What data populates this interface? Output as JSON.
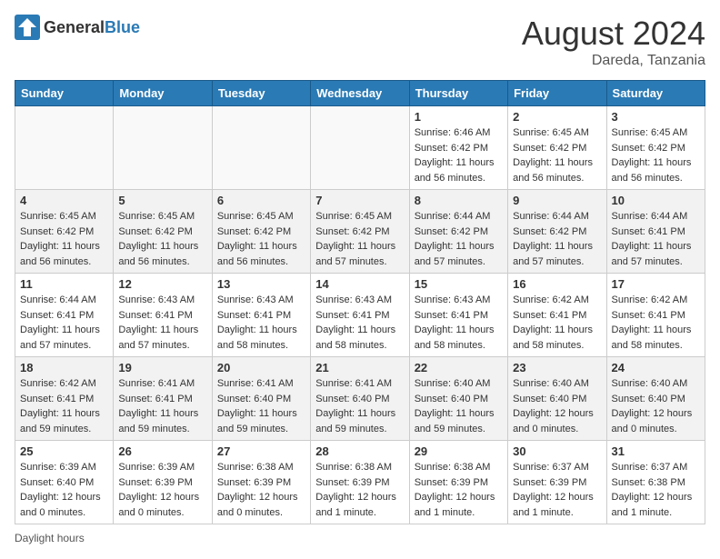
{
  "header": {
    "logo_general": "General",
    "logo_blue": "Blue",
    "month_year": "August 2024",
    "location": "Dareda, Tanzania"
  },
  "days_of_week": [
    "Sunday",
    "Monday",
    "Tuesday",
    "Wednesday",
    "Thursday",
    "Friday",
    "Saturday"
  ],
  "weeks": [
    [
      {
        "day": "",
        "sunrise": "",
        "sunset": "",
        "daylight": "",
        "empty": true
      },
      {
        "day": "",
        "sunrise": "",
        "sunset": "",
        "daylight": "",
        "empty": true
      },
      {
        "day": "",
        "sunrise": "",
        "sunset": "",
        "daylight": "",
        "empty": true
      },
      {
        "day": "",
        "sunrise": "",
        "sunset": "",
        "daylight": "",
        "empty": true
      },
      {
        "day": "1",
        "sunrise": "Sunrise: 6:46 AM",
        "sunset": "Sunset: 6:42 PM",
        "daylight": "Daylight: 11 hours and 56 minutes."
      },
      {
        "day": "2",
        "sunrise": "Sunrise: 6:45 AM",
        "sunset": "Sunset: 6:42 PM",
        "daylight": "Daylight: 11 hours and 56 minutes."
      },
      {
        "day": "3",
        "sunrise": "Sunrise: 6:45 AM",
        "sunset": "Sunset: 6:42 PM",
        "daylight": "Daylight: 11 hours and 56 minutes."
      }
    ],
    [
      {
        "day": "4",
        "sunrise": "Sunrise: 6:45 AM",
        "sunset": "Sunset: 6:42 PM",
        "daylight": "Daylight: 11 hours and 56 minutes."
      },
      {
        "day": "5",
        "sunrise": "Sunrise: 6:45 AM",
        "sunset": "Sunset: 6:42 PM",
        "daylight": "Daylight: 11 hours and 56 minutes."
      },
      {
        "day": "6",
        "sunrise": "Sunrise: 6:45 AM",
        "sunset": "Sunset: 6:42 PM",
        "daylight": "Daylight: 11 hours and 56 minutes."
      },
      {
        "day": "7",
        "sunrise": "Sunrise: 6:45 AM",
        "sunset": "Sunset: 6:42 PM",
        "daylight": "Daylight: 11 hours and 57 minutes."
      },
      {
        "day": "8",
        "sunrise": "Sunrise: 6:44 AM",
        "sunset": "Sunset: 6:42 PM",
        "daylight": "Daylight: 11 hours and 57 minutes."
      },
      {
        "day": "9",
        "sunrise": "Sunrise: 6:44 AM",
        "sunset": "Sunset: 6:42 PM",
        "daylight": "Daylight: 11 hours and 57 minutes."
      },
      {
        "day": "10",
        "sunrise": "Sunrise: 6:44 AM",
        "sunset": "Sunset: 6:41 PM",
        "daylight": "Daylight: 11 hours and 57 minutes."
      }
    ],
    [
      {
        "day": "11",
        "sunrise": "Sunrise: 6:44 AM",
        "sunset": "Sunset: 6:41 PM",
        "daylight": "Daylight: 11 hours and 57 minutes."
      },
      {
        "day": "12",
        "sunrise": "Sunrise: 6:43 AM",
        "sunset": "Sunset: 6:41 PM",
        "daylight": "Daylight: 11 hours and 57 minutes."
      },
      {
        "day": "13",
        "sunrise": "Sunrise: 6:43 AM",
        "sunset": "Sunset: 6:41 PM",
        "daylight": "Daylight: 11 hours and 58 minutes."
      },
      {
        "day": "14",
        "sunrise": "Sunrise: 6:43 AM",
        "sunset": "Sunset: 6:41 PM",
        "daylight": "Daylight: 11 hours and 58 minutes."
      },
      {
        "day": "15",
        "sunrise": "Sunrise: 6:43 AM",
        "sunset": "Sunset: 6:41 PM",
        "daylight": "Daylight: 11 hours and 58 minutes."
      },
      {
        "day": "16",
        "sunrise": "Sunrise: 6:42 AM",
        "sunset": "Sunset: 6:41 PM",
        "daylight": "Daylight: 11 hours and 58 minutes."
      },
      {
        "day": "17",
        "sunrise": "Sunrise: 6:42 AM",
        "sunset": "Sunset: 6:41 PM",
        "daylight": "Daylight: 11 hours and 58 minutes."
      }
    ],
    [
      {
        "day": "18",
        "sunrise": "Sunrise: 6:42 AM",
        "sunset": "Sunset: 6:41 PM",
        "daylight": "Daylight: 11 hours and 59 minutes."
      },
      {
        "day": "19",
        "sunrise": "Sunrise: 6:41 AM",
        "sunset": "Sunset: 6:41 PM",
        "daylight": "Daylight: 11 hours and 59 minutes."
      },
      {
        "day": "20",
        "sunrise": "Sunrise: 6:41 AM",
        "sunset": "Sunset: 6:40 PM",
        "daylight": "Daylight: 11 hours and 59 minutes."
      },
      {
        "day": "21",
        "sunrise": "Sunrise: 6:41 AM",
        "sunset": "Sunset: 6:40 PM",
        "daylight": "Daylight: 11 hours and 59 minutes."
      },
      {
        "day": "22",
        "sunrise": "Sunrise: 6:40 AM",
        "sunset": "Sunset: 6:40 PM",
        "daylight": "Daylight: 11 hours and 59 minutes."
      },
      {
        "day": "23",
        "sunrise": "Sunrise: 6:40 AM",
        "sunset": "Sunset: 6:40 PM",
        "daylight": "Daylight: 12 hours and 0 minutes."
      },
      {
        "day": "24",
        "sunrise": "Sunrise: 6:40 AM",
        "sunset": "Sunset: 6:40 PM",
        "daylight": "Daylight: 12 hours and 0 minutes."
      }
    ],
    [
      {
        "day": "25",
        "sunrise": "Sunrise: 6:39 AM",
        "sunset": "Sunset: 6:40 PM",
        "daylight": "Daylight: 12 hours and 0 minutes."
      },
      {
        "day": "26",
        "sunrise": "Sunrise: 6:39 AM",
        "sunset": "Sunset: 6:39 PM",
        "daylight": "Daylight: 12 hours and 0 minutes."
      },
      {
        "day": "27",
        "sunrise": "Sunrise: 6:38 AM",
        "sunset": "Sunset: 6:39 PM",
        "daylight": "Daylight: 12 hours and 0 minutes."
      },
      {
        "day": "28",
        "sunrise": "Sunrise: 6:38 AM",
        "sunset": "Sunset: 6:39 PM",
        "daylight": "Daylight: 12 hours and 1 minute."
      },
      {
        "day": "29",
        "sunrise": "Sunrise: 6:38 AM",
        "sunset": "Sunset: 6:39 PM",
        "daylight": "Daylight: 12 hours and 1 minute."
      },
      {
        "day": "30",
        "sunrise": "Sunrise: 6:37 AM",
        "sunset": "Sunset: 6:39 PM",
        "daylight": "Daylight: 12 hours and 1 minute."
      },
      {
        "day": "31",
        "sunrise": "Sunrise: 6:37 AM",
        "sunset": "Sunset: 6:38 PM",
        "daylight": "Daylight: 12 hours and 1 minute."
      }
    ]
  ],
  "footer": {
    "note": "Daylight hours"
  }
}
